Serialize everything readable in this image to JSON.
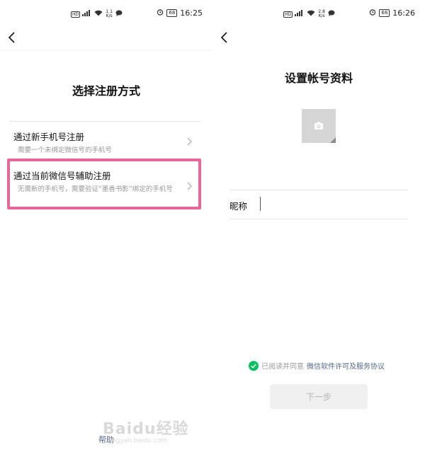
{
  "left_screen": {
    "status_bar": {
      "hd": "HD",
      "signal": "⁴ᴳ",
      "speed_value": "1.1",
      "speed_unit": "K/s",
      "battery": "68",
      "time": "16:25"
    },
    "title": "选择注册方式",
    "options": [
      {
        "title": "通过新手机号注册",
        "description": "需要一个未绑定微信号的手机号"
      },
      {
        "title": "通过当前微信号辅助注册",
        "description": "无需新的手机号，需要验证“墨香书影”绑定的手机号"
      }
    ],
    "help": "帮助",
    "highlight_color": "#e8669a"
  },
  "right_screen": {
    "status_bar": {
      "hd": "HD",
      "signal": "⁴ᴳ",
      "speed_value": "2.8",
      "speed_unit": "K/s",
      "battery": "68",
      "time": "16:26"
    },
    "title": "设置帐号资料",
    "avatar_icon": "camera-icon",
    "nickname_label": "昵称",
    "nickname_value": "",
    "agreement_prefix": "已阅读并同意",
    "agreement_link": "微信软件许可及服务协议",
    "next_button": "下一步",
    "check_color": "#07c160"
  },
  "watermark": {
    "text": "Baidu经验",
    "subtext": "jingyan.baidu.com"
  }
}
